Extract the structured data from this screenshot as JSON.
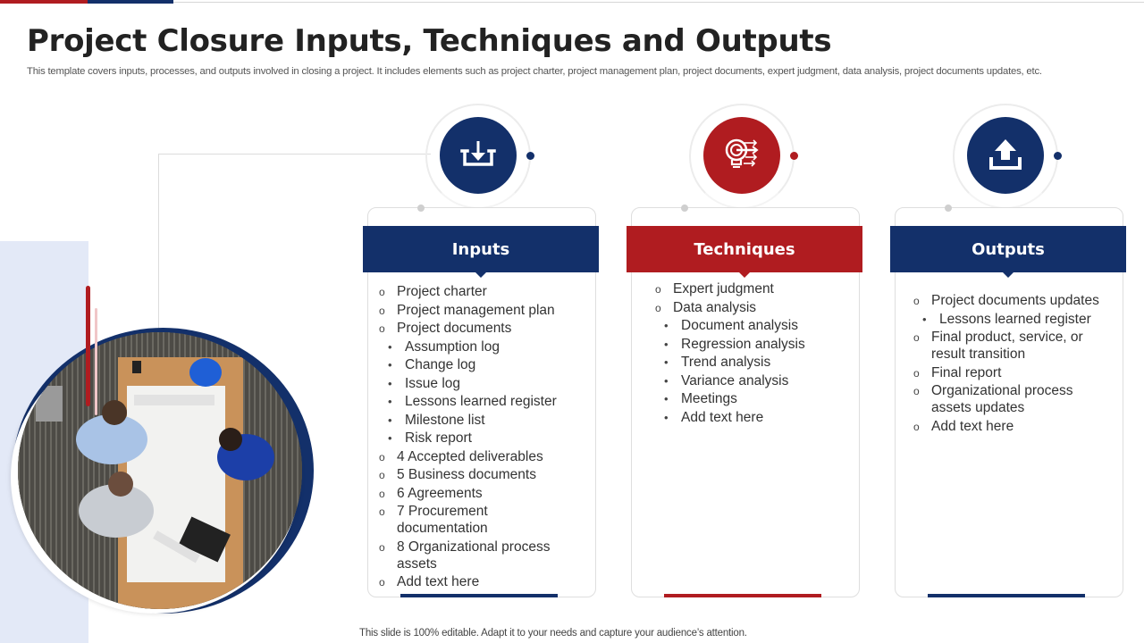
{
  "title": "Project Closure Inputs, Techniques and Outputs",
  "subtitle": "This template covers inputs, processes, and outputs involved in closing a project. It includes elements such as project charter, project management plan, project documents, expert judgment, data analysis, project documents updates, etc.",
  "footer": "This slide is 100% editable. Adapt it to your needs and capture your audience’s attention.",
  "colors": {
    "navy": "#13306a",
    "red": "#b01c20",
    "panel": "#e3e9f7"
  },
  "image": {
    "alt": "team-meeting-photo",
    "description": "Overhead view of team around a table with blueprints"
  },
  "columns": [
    {
      "heading": "Inputs",
      "icon": "download-tray-icon",
      "color": "#13306a",
      "items": [
        {
          "level": 1,
          "text": "Project charter"
        },
        {
          "level": 1,
          "text": "Project management plan"
        },
        {
          "level": 1,
          "text": "Project documents"
        },
        {
          "level": 2,
          "text": "Assumption log"
        },
        {
          "level": 2,
          "text": "Change log"
        },
        {
          "level": 2,
          "text": "Issue log"
        },
        {
          "level": 2,
          "text": "Lessons learned register"
        },
        {
          "level": 2,
          "text": "Milestone list"
        },
        {
          "level": 2,
          "text": "Risk report"
        },
        {
          "level": 1,
          "text": "4 Accepted deliverables"
        },
        {
          "level": 1,
          "text": "5 Business documents"
        },
        {
          "level": 1,
          "text": "6 Agreements"
        },
        {
          "level": 1,
          "text": "7 Procurement documentation"
        },
        {
          "level": 1,
          "text": "8 Organizational process assets"
        },
        {
          "level": 1,
          "text": "Add text here"
        }
      ]
    },
    {
      "heading": "Techniques",
      "icon": "lightbulb-target-icon",
      "color": "#b01c20",
      "items": [
        {
          "level": 1,
          "text": "Expert judgment"
        },
        {
          "level": 1,
          "text": "Data analysis"
        },
        {
          "level": 2,
          "text": "Document analysis"
        },
        {
          "level": 2,
          "text": "Regression analysis"
        },
        {
          "level": 2,
          "text": "Trend analysis"
        },
        {
          "level": 2,
          "text": "Variance analysis"
        },
        {
          "level": 2,
          "text": "Meetings"
        },
        {
          "level": 2,
          "text": "Add text here"
        }
      ]
    },
    {
      "heading": "Outputs",
      "icon": "upload-tray-icon",
      "color": "#13306a",
      "items": [
        {
          "level": 1,
          "text": "Project documents updates"
        },
        {
          "level": 2,
          "text": "Lessons learned register"
        },
        {
          "level": 1,
          "text": "Final product, service, or result transition"
        },
        {
          "level": 1,
          "text": "Final report"
        },
        {
          "level": 1,
          "text": "Organizational process assets updates"
        },
        {
          "level": 1,
          "text": "Add text here"
        }
      ]
    }
  ]
}
